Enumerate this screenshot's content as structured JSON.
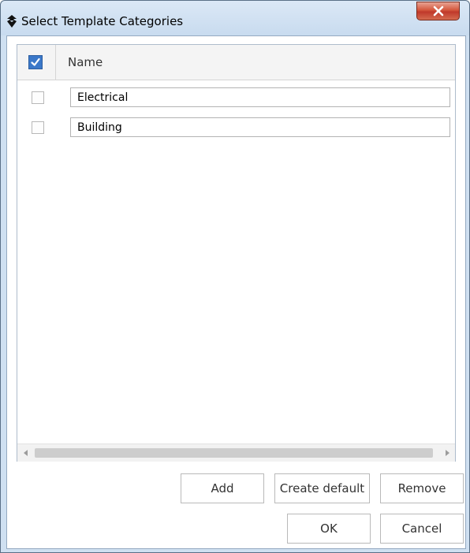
{
  "window": {
    "title": "Select Template Categories",
    "close_icon": "close-icon",
    "app_icon": "app-logo-icon"
  },
  "grid": {
    "header": {
      "select_all_checked": true,
      "name_column": "Name"
    },
    "rows": [
      {
        "checked": false,
        "name": "Electrical"
      },
      {
        "checked": false,
        "name": "Building"
      }
    ]
  },
  "buttons": {
    "add": "Add",
    "create_default": "Create default",
    "remove": "Remove",
    "ok": "OK",
    "cancel": "Cancel"
  },
  "colors": {
    "accent": "#3b78c9",
    "close_button": "#c0392b",
    "titlebar": "#cfe0f1"
  }
}
